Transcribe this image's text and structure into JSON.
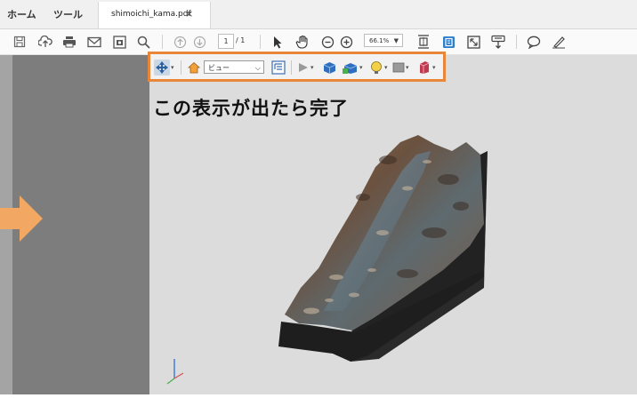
{
  "tabbar": {
    "home_label": "ホーム",
    "tools_label": "ツール",
    "document_tab": "shimoichi_kama.pdf",
    "close_glyph": "×"
  },
  "toolbar": {
    "icons": [
      "save-icon",
      "upload-cloud-icon",
      "print-icon",
      "mail-icon",
      "screenshot-icon",
      "search-icon",
      "page-up-icon",
      "page-down-icon",
      "select-cursor-icon",
      "hand-icon",
      "zoom-out-icon",
      "zoom-in-icon",
      "fit-page-icon",
      "scroll-mode-icon",
      "fullscreen-icon",
      "read-mode-icon",
      "comment-icon",
      "sign-icon"
    ],
    "page_current": "1",
    "page_total": "/ 1",
    "zoom_value": "66.1%"
  },
  "toolbar3d": {
    "view_select": "ビュー",
    "icons": [
      "rotate-tool-icon",
      "home-view-icon",
      "model-tree-icon",
      "play-animation-icon",
      "projection-icon",
      "render-mode-icon",
      "lighting-icon",
      "background-color-icon",
      "cross-section-icon"
    ]
  },
  "caption": "この表示が出たら完了",
  "colors": {
    "highlight_border": "#e8873a",
    "arrow": "#f2a862",
    "viewport_bg": "#dcdcdc",
    "canvas_bg": "#7d7d7d"
  }
}
